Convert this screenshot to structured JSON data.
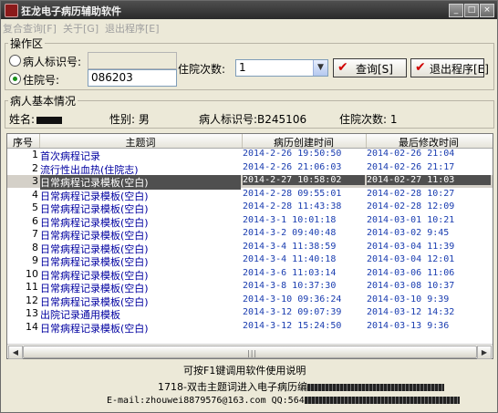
{
  "window": {
    "title": "狂龙电子病历辅助软件",
    "controls": [
      "_",
      "□",
      "×"
    ]
  },
  "menu": {
    "items": [
      "复合查询[F]",
      "关于[G]",
      "退出程序[E]"
    ]
  },
  "operation": {
    "group_title": "操作区",
    "patient_id_label": "病人标识号:",
    "patient_id_value": "",
    "admission_no_label": "住院号:",
    "admission_no_value": "086203",
    "admission_count_label": "住院次数:",
    "admission_count_value": "1",
    "query_button": "查询[S]",
    "exit_button": "退出程序[E]"
  },
  "patient_info": {
    "group_title": "病人基本情况",
    "name_label": "姓名:",
    "gender_label": "性别:",
    "gender_value": "男",
    "patient_id_label": "病人标识号:",
    "patient_id_value": "B245106",
    "admission_count_label": "住院次数:",
    "admission_count_value": "1"
  },
  "table": {
    "columns": [
      "序号",
      "主题词",
      "病历创建时间",
      "最后修改时间"
    ],
    "rows": [
      {
        "seq": "1",
        "topic": "首次病程记录",
        "created": "2014-2-26 19:50:50",
        "modified": "2014-02-26 21:04"
      },
      {
        "seq": "2",
        "topic": "流行性出血热(住院志)",
        "created": "2014-2-26 21:06:03",
        "modified": "2014-02-26 21:17"
      },
      {
        "seq": "3",
        "topic": "日常病程记录模板(空白)",
        "created": "2014-2-27 10:58:02",
        "modified": "2014-02-27 11:03"
      },
      {
        "seq": "4",
        "topic": "日常病程记录模板(空白)",
        "created": "2014-2-28 09:55:01",
        "modified": "2014-02-28 10:27"
      },
      {
        "seq": "5",
        "topic": "日常病程记录模板(空白)",
        "created": "2014-2-28 11:43:38",
        "modified": "2014-02-28 12:09"
      },
      {
        "seq": "6",
        "topic": "日常病程记录模板(空白)",
        "created": "2014-3-1 10:01:18",
        "modified": "2014-03-01 10:21"
      },
      {
        "seq": "7",
        "topic": "日常病程记录模板(空白)",
        "created": "2014-3-2 09:40:48",
        "modified": "2014-03-02 9:45"
      },
      {
        "seq": "8",
        "topic": "日常病程记录模板(空白)",
        "created": "2014-3-4 11:38:59",
        "modified": "2014-03-04 11:39"
      },
      {
        "seq": "9",
        "topic": "日常病程记录模板(空白)",
        "created": "2014-3-4 11:40:18",
        "modified": "2014-03-04 12:01"
      },
      {
        "seq": "10",
        "topic": "日常病程记录模板(空白)",
        "created": "2014-3-6 11:03:14",
        "modified": "2014-03-06 11:06"
      },
      {
        "seq": "11",
        "topic": "日常病程记录模板(空白)",
        "created": "2014-3-8 10:37:30",
        "modified": "2014-03-08 10:37"
      },
      {
        "seq": "12",
        "topic": "日常病程记录模板(空白)",
        "created": "2014-3-10 09:36:24",
        "modified": "2014-03-10 9:39"
      },
      {
        "seq": "13",
        "topic": "出院记录通用模板",
        "created": "2014-3-12 09:07:39",
        "modified": "2014-03-12 14:32"
      },
      {
        "seq": "14",
        "topic": "日常病程记录模板(空白)",
        "created": "2014-3-12 15:24:50",
        "modified": "2014-03-13 9:36"
      }
    ],
    "selected_row": 3
  },
  "footer": {
    "help_text": "可按F1键调用软件使用说明",
    "hint_text": "1718-双击主题词进入电子病历编",
    "contact_text": "E-mail:zhouwei8879576@163.com QQ:564"
  },
  "colors": {
    "title_bar": "#2f2f2f",
    "window_bg": "#ece9d8",
    "row_text": "#0000a0",
    "time_text": "#1a3db0",
    "selection": "#4f4f4f",
    "check_icon": "#d00000"
  }
}
